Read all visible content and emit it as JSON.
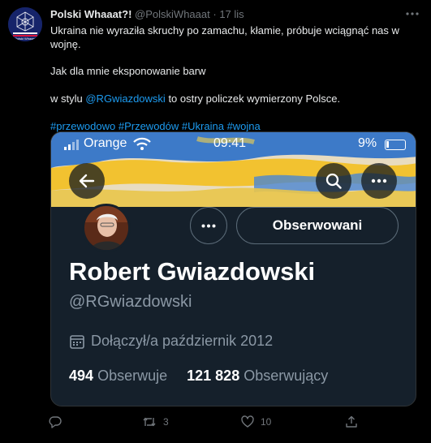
{
  "tweet": {
    "author_name": "Polski Whaaat?!",
    "handle": "@PolskiWhaaat",
    "separator": "·",
    "time": "17 lis",
    "avatar_caption": "Polski Whaaat",
    "text_line1": "Ukraina nie wyraziła skruchy po zamachu, kłamie, próbuje wciągnąć nas w wojnę.",
    "text2_before": "Jak dla mnie eksponowanie barw",
    "text2_middle": "w stylu",
    "text2_mention": "@RGwiazdowski",
    "text2_after": "to ostry policzek wymierzony Polsce.",
    "hashtags": [
      "#przewodowo",
      "#Przewodów",
      "#Ukraina",
      "#wojna"
    ]
  },
  "screenshot": {
    "status_bar": {
      "carrier": "Orange",
      "time": "09:41",
      "battery": "9%"
    },
    "profile": {
      "name": "Robert Gwiazdowski",
      "handle": "@RGwiazdowski",
      "follow_label": "Obserwowani",
      "joined": "Dołączył/a październik 2012",
      "following_count": "494",
      "following_label": "Obserwuje",
      "followers_count": "121 828",
      "followers_label": "Obserwujący"
    }
  },
  "actions": {
    "reply": "",
    "retweets": "3",
    "likes": "10",
    "share": ""
  },
  "icons": [
    "signal-icon",
    "wifi-icon",
    "battery-icon",
    "back-arrow-icon",
    "search-icon",
    "more-icon",
    "calendar-icon",
    "reply-icon",
    "retweet-icon",
    "like-icon",
    "share-icon",
    "flag-icon"
  ],
  "colors": {
    "link": "#1d9bf0",
    "background": "#000000",
    "card": "#15202b",
    "secondary_text": "#71767b",
    "flag_blue": "#0057b7",
    "flag_yellow": "#ffd700"
  }
}
